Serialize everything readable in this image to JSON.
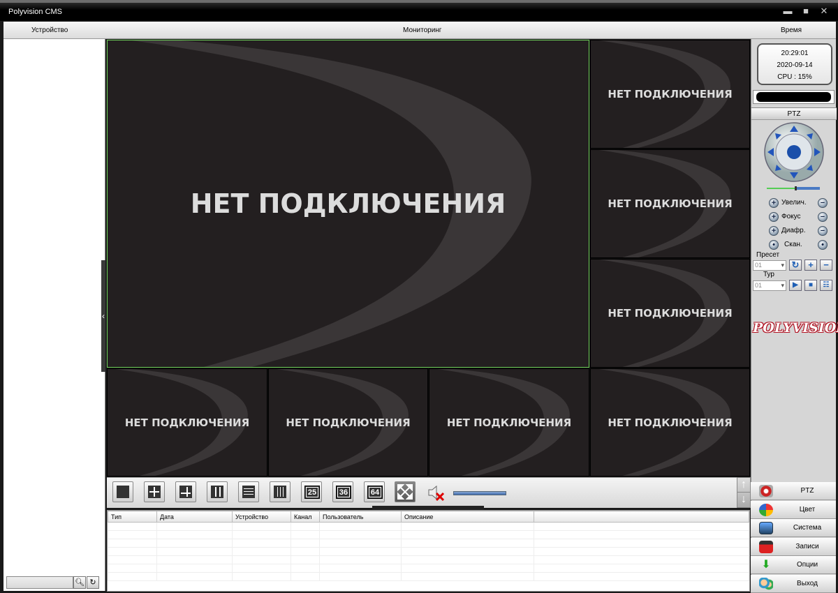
{
  "window": {
    "title": "Polyvision CMS",
    "minimize": "▬",
    "maximize": "■",
    "close": "✕"
  },
  "menu": {
    "device": "Устройство",
    "monitoring": "Мониторинг",
    "time": "Время"
  },
  "video": {
    "no_connection": "НЕТ ПОДКЛЮЧЕНИЯ",
    "layout_labels": [
      "25",
      "36",
      "64"
    ]
  },
  "status": {
    "time": "20:29:01",
    "date": "2020-09-14",
    "cpu": "CPU : 15%"
  },
  "ptz": {
    "header": "PTZ",
    "zoom_label": "Увелич.",
    "focus_label": "Фокус",
    "iris_label": "Диафр.",
    "scan_label": "Скан.",
    "preset_label": "Пресет",
    "preset_value": "01",
    "tour_label": "Тур",
    "tour_value": "01"
  },
  "brand": {
    "logo_text": "POLYVISION",
    "accent": "#b01020"
  },
  "log": {
    "columns": [
      "Тип",
      "Дата",
      "Устройство",
      "Канал",
      "Пользователь",
      "Описание",
      ""
    ]
  },
  "side_buttons": [
    {
      "label": "PTZ",
      "icon": "ptz-icon"
    },
    {
      "label": "Цвет",
      "icon": "color-icon"
    },
    {
      "label": "Система",
      "icon": "system-icon"
    },
    {
      "label": "Записи",
      "icon": "records-icon"
    },
    {
      "label": "Опции",
      "icon": "options-icon"
    },
    {
      "label": "Выход",
      "icon": "logout-icon"
    }
  ]
}
